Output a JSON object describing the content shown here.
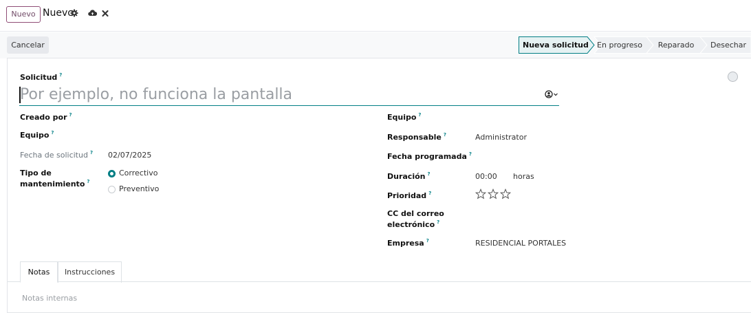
{
  "breadcrumb": {
    "new_button": "Nuevo",
    "title": "Nuevo",
    "icons": [
      "gear-icon",
      "cloud-upload-icon",
      "close-icon"
    ]
  },
  "statusbar": {
    "cancel": "Cancelar",
    "stages": [
      {
        "label": "Nueva solicitud",
        "active": true
      },
      {
        "label": "En progreso",
        "active": false
      },
      {
        "label": "Reparado",
        "active": false
      },
      {
        "label": "Desechar",
        "active": false
      }
    ]
  },
  "form": {
    "request_label": "Solicitud",
    "request_placeholder": "Por ejemplo, no funciona la pantalla",
    "help": "?",
    "left": {
      "created_by": "Creado por",
      "equipment": "Equipo",
      "request_date_label": "Fecha de solicitud",
      "request_date": "02/07/2025",
      "maintenance_type_label_1": "Tipo de",
      "maintenance_type_label_2": "mantenimiento",
      "options": [
        {
          "label": "Correctivo",
          "selected": true
        },
        {
          "label": "Preventivo",
          "selected": false
        }
      ]
    },
    "right": {
      "team": "Equipo",
      "responsible_label": "Responsable",
      "responsible": "Administrator",
      "scheduled_date": "Fecha programada",
      "duration_label": "Duración",
      "duration": "00:00",
      "duration_unit": "horas",
      "priority_label": "Prioridad",
      "priority": 0,
      "priority_max": 3,
      "email_cc_1": "CC del correo",
      "email_cc_2": "electrónico",
      "company_label": "Empresa",
      "company": "RESIDENCIAL PORTALES"
    }
  },
  "tabs": [
    {
      "label": "Notas",
      "active": true
    },
    {
      "label": "Instrucciones",
      "active": false
    }
  ],
  "notes_placeholder": "Notas internas",
  "colors": {
    "brand": "#714B67",
    "accent": "#017e84",
    "stage_active_border": "#017e84"
  }
}
